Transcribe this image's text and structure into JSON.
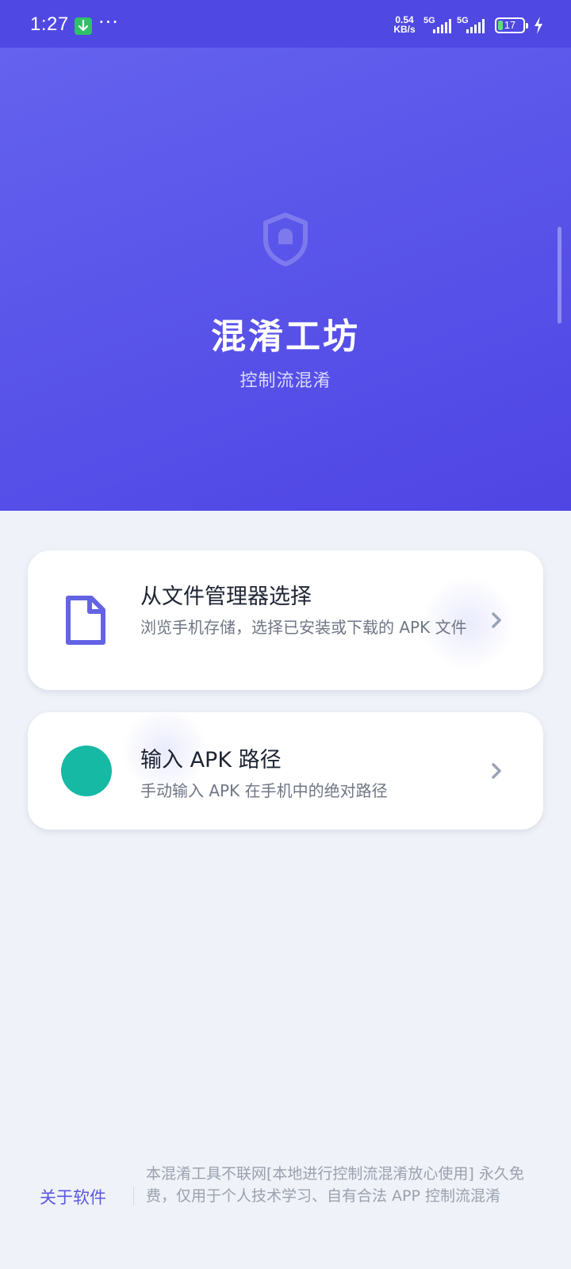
{
  "status_bar": {
    "time": "1:27",
    "net_speed_value": "0.54",
    "net_speed_unit": "KB/s",
    "sim1_label": "5G",
    "sim2_label": "5G",
    "battery_level": "17"
  },
  "hero": {
    "title": "混淆工坊",
    "subtitle": "控制流混淆",
    "icon": "shield-icon"
  },
  "options": [
    {
      "title": "从文件管理器选择",
      "description": "浏览手机存储，选择已安装或下载的 APK 文件",
      "icon": "file-icon",
      "accent_color": "#6463e6"
    },
    {
      "title": "输入 APK 路径",
      "description": "手动输入 APK 在手机中的绝对路径",
      "icon": "circle-icon",
      "accent_color": "#16b9a4"
    }
  ],
  "footer": {
    "about_label": "关于软件",
    "disclaimer": "本混淆工具不联网[本地进行控制流混淆放心使用] 永久免费，仅用于个人技术学习、自有合法 APP 控制流混淆"
  },
  "colors": {
    "primary": "#5a55ea",
    "background": "#eff2f8",
    "card": "#ffffff"
  }
}
